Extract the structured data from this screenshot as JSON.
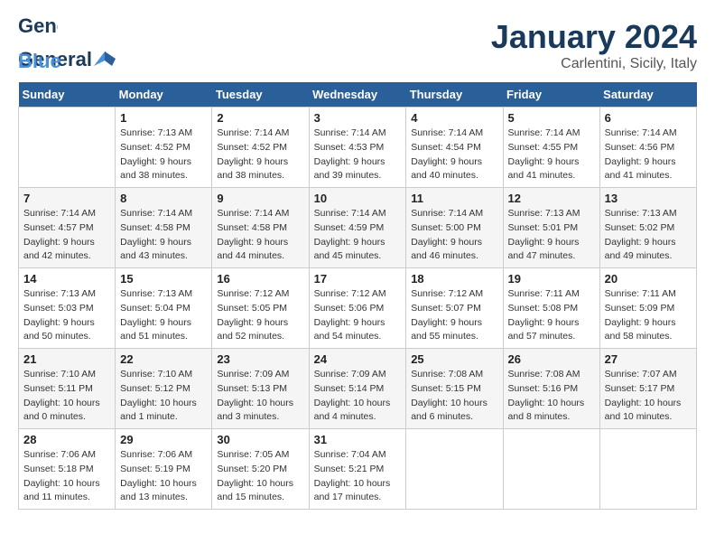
{
  "header": {
    "logo_general": "General",
    "logo_blue": "Blue",
    "month": "January 2024",
    "location": "Carlentini, Sicily, Italy"
  },
  "columns": [
    "Sunday",
    "Monday",
    "Tuesday",
    "Wednesday",
    "Thursday",
    "Friday",
    "Saturday"
  ],
  "weeks": [
    [
      {
        "day": "",
        "info": ""
      },
      {
        "day": "1",
        "info": "Sunrise: 7:13 AM\nSunset: 4:52 PM\nDaylight: 9 hours\nand 38 minutes."
      },
      {
        "day": "2",
        "info": "Sunrise: 7:14 AM\nSunset: 4:52 PM\nDaylight: 9 hours\nand 38 minutes."
      },
      {
        "day": "3",
        "info": "Sunrise: 7:14 AM\nSunset: 4:53 PM\nDaylight: 9 hours\nand 39 minutes."
      },
      {
        "day": "4",
        "info": "Sunrise: 7:14 AM\nSunset: 4:54 PM\nDaylight: 9 hours\nand 40 minutes."
      },
      {
        "day": "5",
        "info": "Sunrise: 7:14 AM\nSunset: 4:55 PM\nDaylight: 9 hours\nand 41 minutes."
      },
      {
        "day": "6",
        "info": "Sunrise: 7:14 AM\nSunset: 4:56 PM\nDaylight: 9 hours\nand 41 minutes."
      }
    ],
    [
      {
        "day": "7",
        "info": "Sunrise: 7:14 AM\nSunset: 4:57 PM\nDaylight: 9 hours\nand 42 minutes."
      },
      {
        "day": "8",
        "info": "Sunrise: 7:14 AM\nSunset: 4:58 PM\nDaylight: 9 hours\nand 43 minutes."
      },
      {
        "day": "9",
        "info": "Sunrise: 7:14 AM\nSunset: 4:58 PM\nDaylight: 9 hours\nand 44 minutes."
      },
      {
        "day": "10",
        "info": "Sunrise: 7:14 AM\nSunset: 4:59 PM\nDaylight: 9 hours\nand 45 minutes."
      },
      {
        "day": "11",
        "info": "Sunrise: 7:14 AM\nSunset: 5:00 PM\nDaylight: 9 hours\nand 46 minutes."
      },
      {
        "day": "12",
        "info": "Sunrise: 7:13 AM\nSunset: 5:01 PM\nDaylight: 9 hours\nand 47 minutes."
      },
      {
        "day": "13",
        "info": "Sunrise: 7:13 AM\nSunset: 5:02 PM\nDaylight: 9 hours\nand 49 minutes."
      }
    ],
    [
      {
        "day": "14",
        "info": "Sunrise: 7:13 AM\nSunset: 5:03 PM\nDaylight: 9 hours\nand 50 minutes."
      },
      {
        "day": "15",
        "info": "Sunrise: 7:13 AM\nSunset: 5:04 PM\nDaylight: 9 hours\nand 51 minutes."
      },
      {
        "day": "16",
        "info": "Sunrise: 7:12 AM\nSunset: 5:05 PM\nDaylight: 9 hours\nand 52 minutes."
      },
      {
        "day": "17",
        "info": "Sunrise: 7:12 AM\nSunset: 5:06 PM\nDaylight: 9 hours\nand 54 minutes."
      },
      {
        "day": "18",
        "info": "Sunrise: 7:12 AM\nSunset: 5:07 PM\nDaylight: 9 hours\nand 55 minutes."
      },
      {
        "day": "19",
        "info": "Sunrise: 7:11 AM\nSunset: 5:08 PM\nDaylight: 9 hours\nand 57 minutes."
      },
      {
        "day": "20",
        "info": "Sunrise: 7:11 AM\nSunset: 5:09 PM\nDaylight: 9 hours\nand 58 minutes."
      }
    ],
    [
      {
        "day": "21",
        "info": "Sunrise: 7:10 AM\nSunset: 5:11 PM\nDaylight: 10 hours\nand 0 minutes."
      },
      {
        "day": "22",
        "info": "Sunrise: 7:10 AM\nSunset: 5:12 PM\nDaylight: 10 hours\nand 1 minute."
      },
      {
        "day": "23",
        "info": "Sunrise: 7:09 AM\nSunset: 5:13 PM\nDaylight: 10 hours\nand 3 minutes."
      },
      {
        "day": "24",
        "info": "Sunrise: 7:09 AM\nSunset: 5:14 PM\nDaylight: 10 hours\nand 4 minutes."
      },
      {
        "day": "25",
        "info": "Sunrise: 7:08 AM\nSunset: 5:15 PM\nDaylight: 10 hours\nand 6 minutes."
      },
      {
        "day": "26",
        "info": "Sunrise: 7:08 AM\nSunset: 5:16 PM\nDaylight: 10 hours\nand 8 minutes."
      },
      {
        "day": "27",
        "info": "Sunrise: 7:07 AM\nSunset: 5:17 PM\nDaylight: 10 hours\nand 10 minutes."
      }
    ],
    [
      {
        "day": "28",
        "info": "Sunrise: 7:06 AM\nSunset: 5:18 PM\nDaylight: 10 hours\nand 11 minutes."
      },
      {
        "day": "29",
        "info": "Sunrise: 7:06 AM\nSunset: 5:19 PM\nDaylight: 10 hours\nand 13 minutes."
      },
      {
        "day": "30",
        "info": "Sunrise: 7:05 AM\nSunset: 5:20 PM\nDaylight: 10 hours\nand 15 minutes."
      },
      {
        "day": "31",
        "info": "Sunrise: 7:04 AM\nSunset: 5:21 PM\nDaylight: 10 hours\nand 17 minutes."
      },
      {
        "day": "",
        "info": ""
      },
      {
        "day": "",
        "info": ""
      },
      {
        "day": "",
        "info": ""
      }
    ]
  ]
}
